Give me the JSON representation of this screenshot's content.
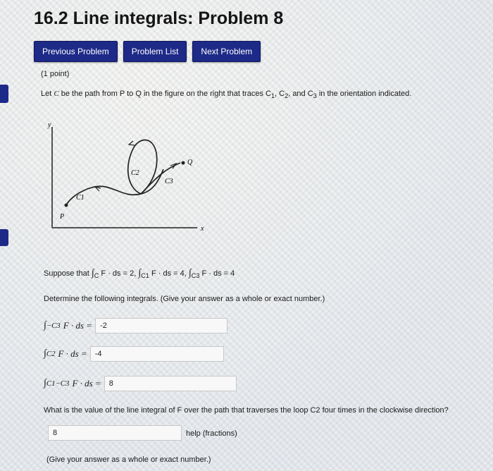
{
  "title": "16.2 Line integrals: Problem 8",
  "nav": {
    "previous": "Previous Problem",
    "list": "Problem List",
    "next": "Next Problem"
  },
  "problem": {
    "points": "(1 point)",
    "statement_prefix": "Let ",
    "statement_var": "C",
    "statement_rest": " be the path from P to Q in the figure on the right that traces C",
    "statement_sub1": "1",
    "statement_sep1": ", C",
    "statement_sub2": "2",
    "statement_sep2": ", and C",
    "statement_sub3": "3",
    "statement_end": " in the orientation indicated."
  },
  "figure": {
    "y_label": "y",
    "x_label": "x",
    "p_label": "P",
    "q_label": "Q",
    "c1_label": "C1",
    "c2_label": "C2",
    "c3_label": "C3"
  },
  "given": {
    "prefix": "Suppose that ",
    "eq1_sub": "C",
    "eq1_expr": "F · ds = 2",
    "eq2_sub": "C1",
    "eq2_expr": "F · ds = 4",
    "eq3_sub": "C3",
    "eq3_expr": "F · ds = 4"
  },
  "instructions": "Determine the following integrals. (Give your answer as a whole or exact number.)",
  "answers": [
    {
      "sub": "−C3",
      "expr": "F · ds =",
      "value": "-2"
    },
    {
      "sub": "C2",
      "expr": "F · ds =",
      "value": "-4"
    },
    {
      "sub": "C1−C3",
      "expr": "F · ds =",
      "value": "8"
    }
  ],
  "loop_question": {
    "text": "What is the value of the line integral of F over the path that traverses the loop C2 four times in the clockwise direction?",
    "value": "8",
    "help": "help (fractions)"
  },
  "footer": "(Give your answer as a whole or exact number.)",
  "colors": {
    "button": "#1d2a88",
    "sidebar_marker": "#1d2a88"
  }
}
